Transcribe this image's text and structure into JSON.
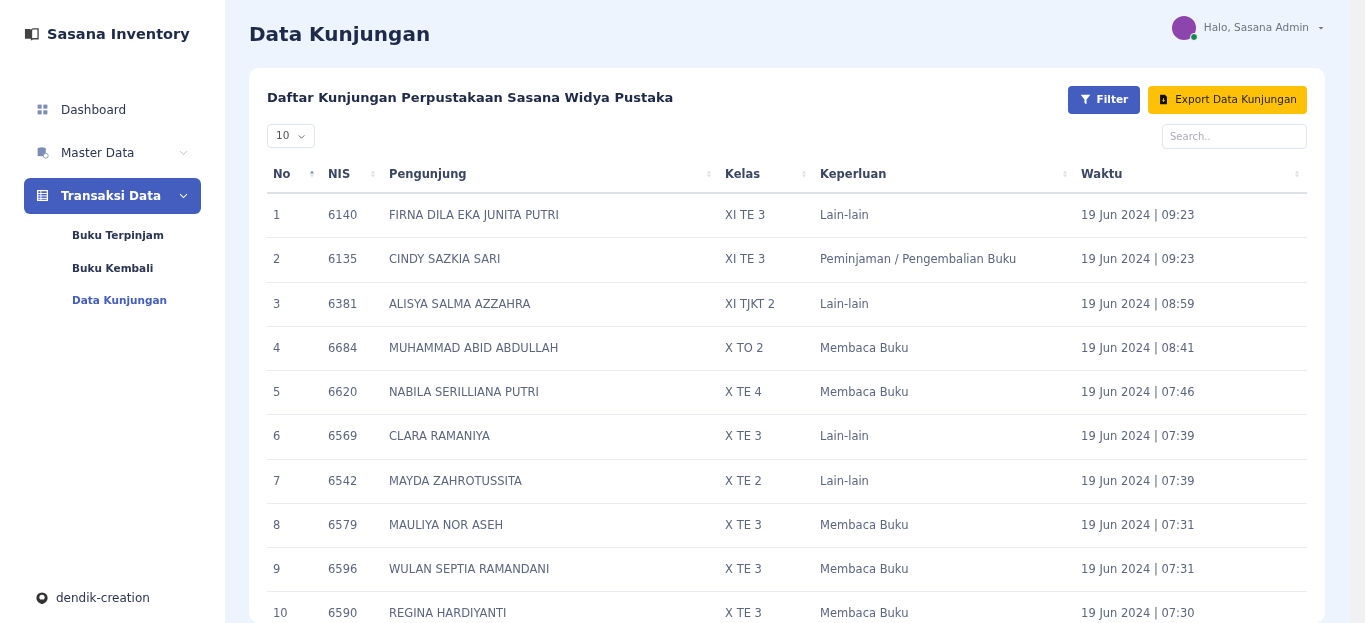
{
  "brand": "Sasana Inventory",
  "sidebar": {
    "items": [
      {
        "label": "Dashboard",
        "kind": "grid",
        "selected": false
      },
      {
        "label": "Master Data",
        "kind": "database",
        "selected": false,
        "expanded": false
      },
      {
        "label": "Transaksi Data",
        "kind": "table",
        "selected": true,
        "expanded": true,
        "children": [
          {
            "label": "Buku Terpinjam",
            "selected": false
          },
          {
            "label": "Buku Kembali",
            "selected": false
          },
          {
            "label": "Data Kunjungan",
            "selected": true
          }
        ]
      }
    ],
    "footer_link": "dendik-creation"
  },
  "page_title": "Data Kunjungan",
  "user": {
    "greeting": "Halo, Sasana Admin",
    "online": true
  },
  "card": {
    "title": "Daftar Kunjungan Perpustakaan Sasana Widya Pustaka",
    "buttons": [
      {
        "label": "Filter",
        "kind": "filter"
      },
      {
        "label": "Export Data Kunjungan",
        "kind": "export"
      }
    ],
    "page_size": "10",
    "search": {
      "placeholder": "Search.."
    }
  },
  "table": {
    "columns": [
      {
        "label": "No",
        "sorted": true
      },
      {
        "label": "NIS",
        "sorted": false
      },
      {
        "label": "Pengunjung",
        "sorted": false
      },
      {
        "label": "Kelas",
        "sorted": false
      },
      {
        "label": "Keperluan",
        "sorted": false
      },
      {
        "label": "Waktu",
        "sorted": false
      }
    ],
    "rows": [
      [
        "1",
        "6140",
        "FIRNA DILA EKA JUNITA PUTRI",
        "XI TE 3",
        "Lain-lain",
        "19 Jun 2024 | 09:23"
      ],
      [
        "2",
        "6135",
        "CINDY SAZKIA SARI",
        "XI TE 3",
        "Peminjaman / Pengembalian Buku",
        "19 Jun 2024 | 09:23"
      ],
      [
        "3",
        "6381",
        "ALISYA SALMA AZZAHRA",
        "XI TJKT 2",
        "Lain-lain",
        "19 Jun 2024 | 08:59"
      ],
      [
        "4",
        "6684",
        "MUHAMMAD ABID ABDULLAH",
        "X TO 2",
        "Membaca Buku",
        "19 Jun 2024 | 08:41"
      ],
      [
        "5",
        "6620",
        "NABILA SERILLIANA PUTRI",
        "X TE 4",
        "Membaca Buku",
        "19 Jun 2024 | 07:46"
      ],
      [
        "6",
        "6569",
        "CLARA RAMANIYA",
        "X TE 3",
        "Lain-lain",
        "19 Jun 2024 | 07:39"
      ],
      [
        "7",
        "6542",
        "MAYDA ZAHROTUSSITA",
        "X TE 2",
        "Lain-lain",
        "19 Jun 2024 | 07:39"
      ],
      [
        "8",
        "6579",
        "MAULIYA NOR ASEH",
        "X TE 3",
        "Membaca Buku",
        "19 Jun 2024 | 07:31"
      ],
      [
        "9",
        "6596",
        "WULAN SEPTIA RAMANDANI",
        "X TE 3",
        "Membaca Buku",
        "19 Jun 2024 | 07:31"
      ],
      [
        "10",
        "6590",
        "REGINA HARDIYANTI",
        "X TE 3",
        "Membaca Buku",
        "19 Jun 2024 | 07:30"
      ]
    ]
  }
}
